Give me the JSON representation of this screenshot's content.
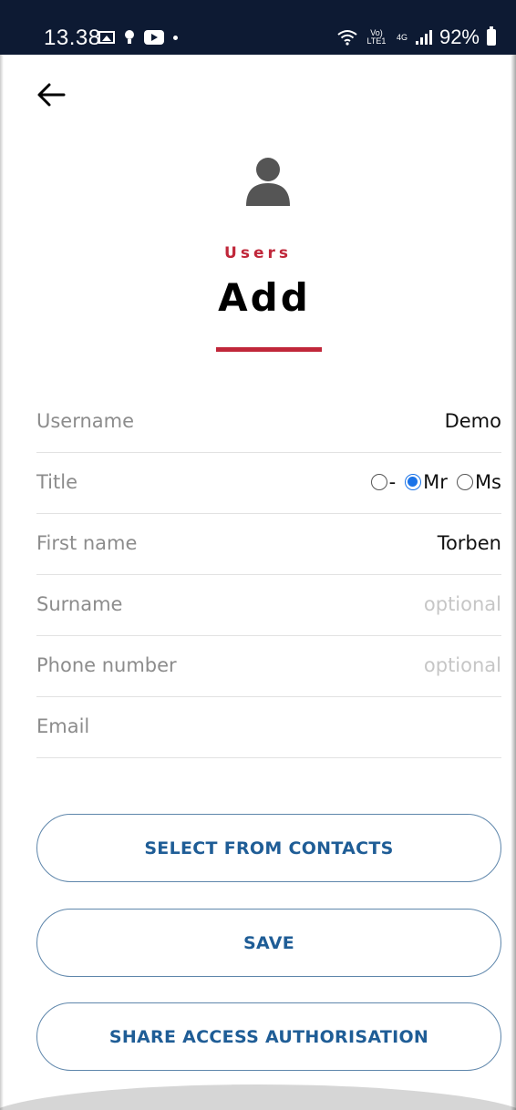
{
  "status_bar": {
    "time": "13.38",
    "battery": "92%",
    "network_label": "Vo) LTE1",
    "network_type": "4G"
  },
  "header": {
    "section": "Users",
    "title": "Add"
  },
  "form": {
    "fields": [
      {
        "label": "Username",
        "value": "Demo",
        "placeholder": ""
      },
      {
        "label": "Title",
        "value": "",
        "placeholder": ""
      },
      {
        "label": "First name",
        "value": "Torben",
        "placeholder": ""
      },
      {
        "label": "Surname",
        "value": "",
        "placeholder": "optional"
      },
      {
        "label": "Phone number",
        "value": "",
        "placeholder": "optional"
      },
      {
        "label": "Email",
        "value": "",
        "placeholder": ""
      }
    ],
    "title_options": [
      {
        "label": "-",
        "selected": false
      },
      {
        "label": "Mr",
        "selected": true
      },
      {
        "label": "Ms",
        "selected": false
      }
    ]
  },
  "buttons": {
    "select_contacts": "SELECT FROM CONTACTS",
    "save": "SAVE",
    "share": "SHARE ACCESS AUTHORISATION"
  },
  "colors": {
    "accent_red": "#c0273a",
    "button_text": "#1f5d96",
    "button_border": "#5e86ab",
    "radio_selected": "#1a73e8",
    "status_bar": "#0d1a33"
  }
}
